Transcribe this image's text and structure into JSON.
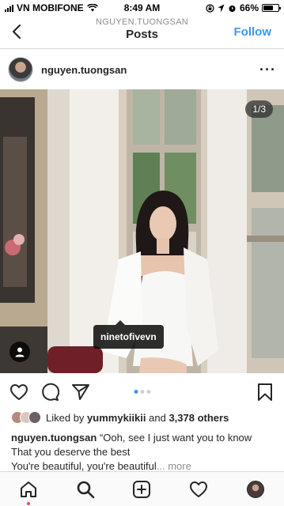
{
  "status_bar": {
    "carrier": "VN MOBIFONE",
    "time": "8:49 AM",
    "battery_percent": "66%",
    "battery_level": 0.66
  },
  "nav": {
    "subtitle": "NGUYEN.TUONGSAN",
    "title": "Posts",
    "follow_label": "Follow"
  },
  "post": {
    "username": "nguyen.tuongsan",
    "page_counter": "1/3",
    "tagged_user": "ninetofivevn",
    "carousel": {
      "count": 3,
      "active": 0
    }
  },
  "likes": {
    "prefix": "Liked by",
    "user": "yummykiikii",
    "and": "and",
    "others": "3,378 others"
  },
  "caption": {
    "username": "nguyen.tuongsan",
    "line1": "“Ooh, see I just want you to know",
    "line2": "That you deserve the best",
    "line3": "You're beautiful, you're beautiful",
    "ellipsis": "...",
    "more": "more"
  },
  "tabs": [
    "home-icon",
    "search-icon",
    "add-post-icon",
    "activity-heart-icon",
    "profile-avatar"
  ],
  "colors": {
    "accent": "#3897f0",
    "notification": "#ed4956",
    "text": "#262626",
    "muted": "#8e8e8e"
  }
}
